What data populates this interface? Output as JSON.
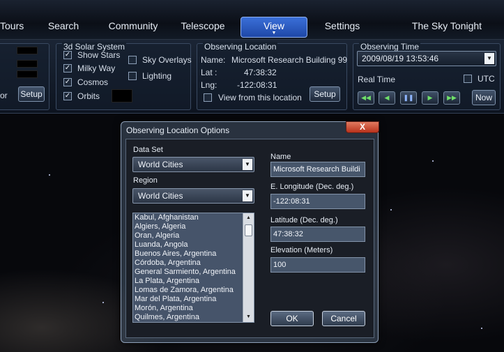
{
  "tabs": [
    {
      "label": "Tours"
    },
    {
      "label": "Search"
    },
    {
      "label": "Community"
    },
    {
      "label": "Telescope"
    },
    {
      "label": "View",
      "active": true
    },
    {
      "label": "Settings"
    },
    {
      "label": "The Sky Tonight"
    }
  ],
  "left_panel": {
    "partial_label": "or",
    "setup_label": "Setup"
  },
  "solar_system": {
    "title": "3d Solar System",
    "show_stars": {
      "label": "Show Stars",
      "checked": true
    },
    "milky_way": {
      "label": "Milky Way",
      "checked": true
    },
    "cosmos": {
      "label": "Cosmos",
      "checked": true
    },
    "orbits": {
      "label": "Orbits",
      "checked": true
    },
    "sky_overlays": {
      "label": "Sky Overlays",
      "checked": false
    },
    "lighting": {
      "label": "Lighting",
      "checked": false
    }
  },
  "observing_location": {
    "title": "Observing Location",
    "name_label": "Name:",
    "name_value": "Microsoft Research Building 99",
    "lat_label": "Lat :",
    "lat_value": "47:38:32",
    "lng_label": "Lng:",
    "lng_value": "-122:08:31",
    "view_from_label": "View from this location",
    "view_from_checked": false,
    "setup_label": "Setup"
  },
  "observing_time": {
    "title": "Observing Time",
    "datetime": "2009/08/19   13:53:46",
    "real_time_label": "Real Time",
    "utc_label": "UTC",
    "utc_checked": false,
    "now_label": "Now",
    "controls": [
      "fast-rewind",
      "rewind",
      "pause",
      "forward",
      "fast-forward"
    ]
  },
  "dialog": {
    "title": "Observing Location Options",
    "close_glyph": "X",
    "data_set_label": "Data Set",
    "data_set_value": "World Cities",
    "region_label": "Region",
    "region_value": "World Cities",
    "cities": [
      "Kabul, Afghanistan",
      "Algiers, Algeria",
      "Oran, Algeria",
      "Luanda, Angola",
      "Buenos Aires, Argentina",
      "Córdoba, Argentina",
      "General Sarmiento, Argentina",
      "La Plata, Argentina",
      "Lomas de Zamora, Argentina",
      "Mar del Plata, Argentina",
      "Morón, Argentina",
      "Quilmes, Argentina"
    ],
    "name_label": "Name",
    "name_value": "Microsoft Research Buildi",
    "longitude_label": "E. Longitude (Dec. deg.)",
    "longitude_value": "-122:08:31",
    "latitude_label": "Latitude (Dec. deg.)",
    "latitude_value": "47:38:32",
    "elevation_label": "Elevation (Meters)",
    "elevation_value": "100",
    "ok_label": "OK",
    "cancel_label": "Cancel"
  }
}
